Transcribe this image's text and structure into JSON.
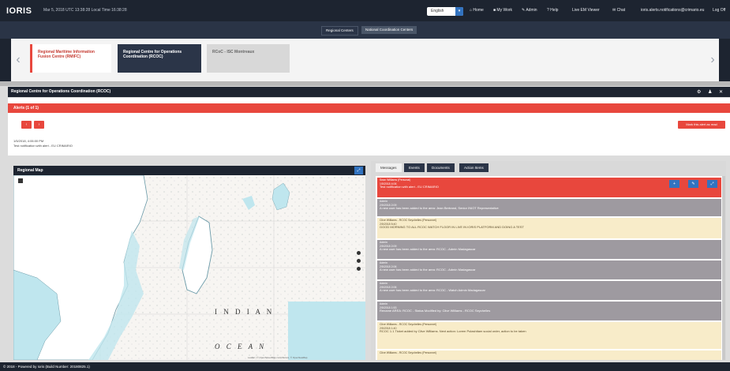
{
  "app": {
    "logo": "IORIS",
    "datetime": "Mar 5, 2018   UTC 13:38:28   Local Time 16:38:28"
  },
  "topnav": {
    "language": "English",
    "links": [
      "Home",
      "My Work",
      "Admin",
      "Help",
      "Live EM Viewer",
      "Chat",
      "ioris.alerts.notifications@crimario.eu",
      "Log Off"
    ]
  },
  "subtabs": [
    "Regional Centers",
    "National Coordination Centers"
  ],
  "centers": [
    "Regional Maritime Information Fusion Centre (RMIFC)",
    "Regional Centre for Operations Coordination (RCOC)",
    "RCoC - ISC Montreaux"
  ],
  "section": {
    "title": "Regional Centre for Operations Coordination (RCOC)"
  },
  "alerts": {
    "header": "Alerts (1 of 1)",
    "prev": "‹",
    "next": "›",
    "mark_read": "Mark this alert as read",
    "date": "1/5/2018, 4:06:00 PM",
    "message": "Test notification with alert - EU CRIMARIO"
  },
  "map": {
    "title": "Regional Map",
    "labels": [
      "I N D I A N",
      "O C E A N"
    ],
    "attribution": "Leaflet | © OpenStreetMap contributors, © OpenSeaMap"
  },
  "messages": {
    "tabs": [
      "Messages",
      "Events",
      "Documents",
      "Action Items"
    ],
    "items": [
      {
        "type": "red",
        "sender": "Sean Williams (Personal)",
        "time": "1/5/2018 4:06",
        "body": "Test notification with alert - EU CRIMARIO"
      },
      {
        "type": "gray",
        "sender": "Admin",
        "time": "2/5/2018 2:09",
        "body": "A new user has been added to the area: Jean Bertrand, Senior INIOT Representative"
      },
      {
        "type": "cream",
        "sender": "Clive Williams - RCOC Seychelles (Personnel)",
        "time": "2/5/2018 5:40",
        "body": "GOOD MORNING TO ALL RCOC WATCH FLOOR IN LIVE IN IORIS PLATFORM AND DOING A TEST"
      },
      {
        "type": "gray",
        "sender": "Admin",
        "time": "2/5/2018 2:09",
        "body": "A new user has been added to the area: RCOC - Admin Madagascar"
      },
      {
        "type": "gray",
        "sender": "Admin",
        "time": "2/5/2018 2:06",
        "body": "A new user has been added to the area: RCOC - Admin Madagascar"
      },
      {
        "type": "gray",
        "sender": "Admin",
        "time": "2/5/2018 2:06",
        "body": "A new user has been added to the area: RCOC - Watch Admin Madagascar"
      },
      {
        "type": "gray",
        "sender": "Admin",
        "time": "2/5/2018 1:53",
        "body": "Rename AREA: RCOC - Status Modified by: Clive Williams - RCOC Seychelles"
      },
      {
        "type": "cream",
        "sender": "Clive Williams - RCOC Seychelles (Personnel)",
        "time": "2/5/2018 1:40",
        "body": "RCOC 1.1 Ticket added by Clive Williams. Next action: Lorem Pulashitam social order, action to be taken"
      },
      {
        "type": "cream",
        "sender": "Clive Williams - RCOC Seychelles (Personnel)",
        "time": "2/5/2018 1:38",
        "body": ""
      }
    ]
  },
  "footer": {
    "text": "© 2018 - Powered by Ioris (Build Number: 20180825.1)"
  }
}
